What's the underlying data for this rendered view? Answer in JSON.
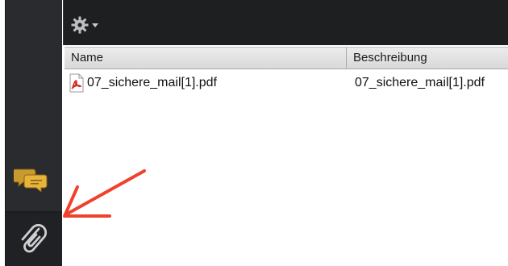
{
  "toolbar": {
    "settings_icon": "gear-icon",
    "menu_caret": "chevron-down-icon"
  },
  "sidebar": {
    "items": [
      {
        "icon": "chat-bubbles-icon"
      },
      {
        "icon": "paperclip-icon"
      }
    ]
  },
  "table": {
    "columns": [
      "Name",
      "Beschreibung"
    ],
    "rows": [
      {
        "icon": "pdf-icon",
        "name": "07_sichere_mail[1].pdf",
        "description": "07_sichere_mail[1].pdf"
      }
    ]
  },
  "annotation": {
    "arrow_color": "#f0412d"
  }
}
